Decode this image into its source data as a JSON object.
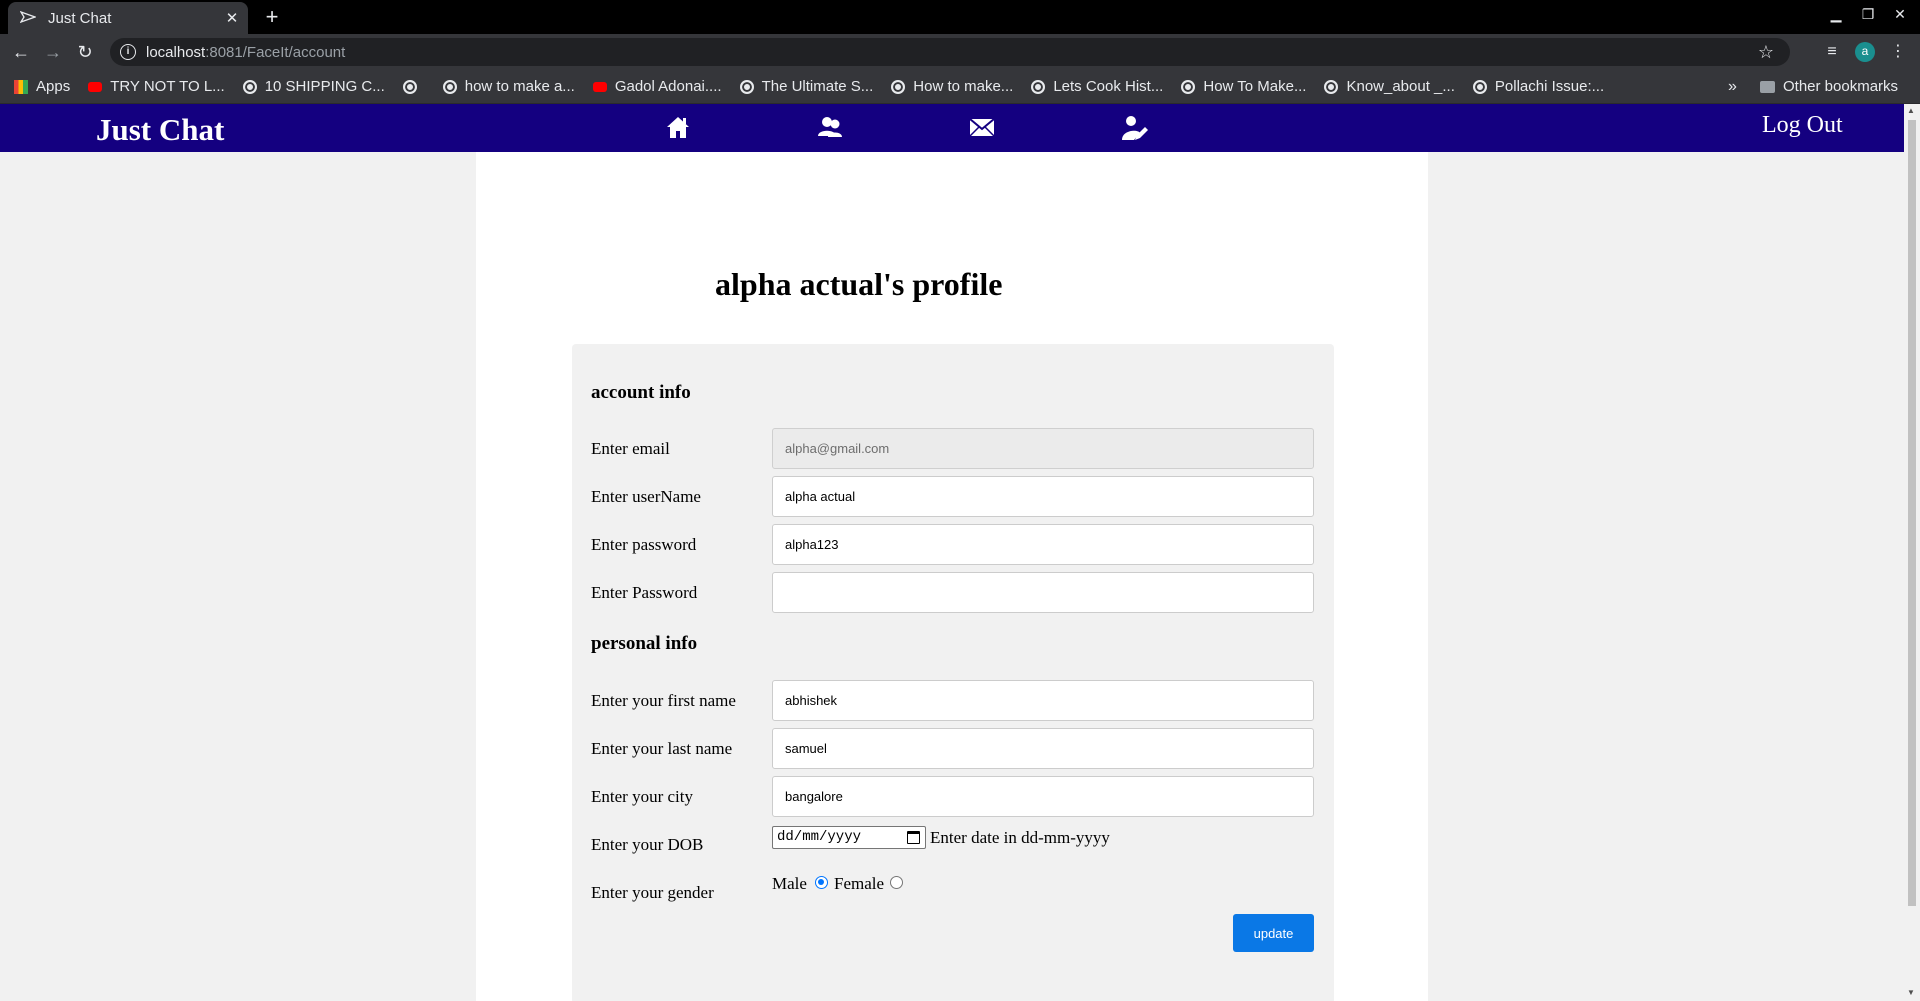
{
  "browser": {
    "tab_title": "Just Chat",
    "url_host": "localhost",
    "url_path": ":8081/FaceIt/account",
    "avatar_letter": "a",
    "bookmarks": [
      {
        "label": "Apps",
        "icon": "apps-grid-icon"
      },
      {
        "label": "TRY NOT TO L...",
        "icon": "youtube-icon"
      },
      {
        "label": "10 SHIPPING C...",
        "icon": "globe-icon"
      },
      {
        "label": "",
        "icon": "globe-icon"
      },
      {
        "label": "how to make a...",
        "icon": "globe-icon"
      },
      {
        "label": "Gadol Adonai....",
        "icon": "youtube-icon"
      },
      {
        "label": "The Ultimate S...",
        "icon": "globe-icon"
      },
      {
        "label": "How to make...",
        "icon": "globe-icon"
      },
      {
        "label": "Lets Cook Hist...",
        "icon": "globe-icon"
      },
      {
        "label": "How To Make...",
        "icon": "globe-icon"
      },
      {
        "label": "Know_about _...",
        "icon": "globe-icon"
      },
      {
        "label": "Pollachi Issue:...",
        "icon": "globe-icon"
      }
    ],
    "more_bookmarks": "»",
    "other_bookmarks": "Other bookmarks"
  },
  "navbar": {
    "brand": "Just Chat",
    "icons": [
      "home-icon",
      "friends-icon",
      "mail-icon",
      "edit-profile-icon"
    ],
    "logout_label": "Log Out",
    "bg_color": "#140080"
  },
  "profile": {
    "title": "alpha actual's profile",
    "account_section": "account info",
    "personal_section": "personal info",
    "fields": {
      "email": {
        "label": "Enter email",
        "value": "alpha@gmail.com"
      },
      "username": {
        "label": "Enter userName",
        "value": "alpha actual"
      },
      "password": {
        "label": "Enter password",
        "value": "alpha123"
      },
      "password_confirm": {
        "label": "Enter Password",
        "value": ""
      },
      "first_name": {
        "label": "Enter your first name",
        "value": "abhishek"
      },
      "last_name": {
        "label": "Enter your last name",
        "value": "samuel"
      },
      "city": {
        "label": "Enter your city",
        "value": "bangalore"
      },
      "dob": {
        "label": "Enter your DOB",
        "placeholder": "dd/mm/yyyy",
        "hint": "Enter date in dd-mm-yyyy"
      },
      "gender": {
        "label": "Enter your gender",
        "option_male": "Male",
        "option_female": "Female",
        "selected": "Male"
      }
    },
    "update_label": "update",
    "accent_color": "#0a78e6"
  }
}
